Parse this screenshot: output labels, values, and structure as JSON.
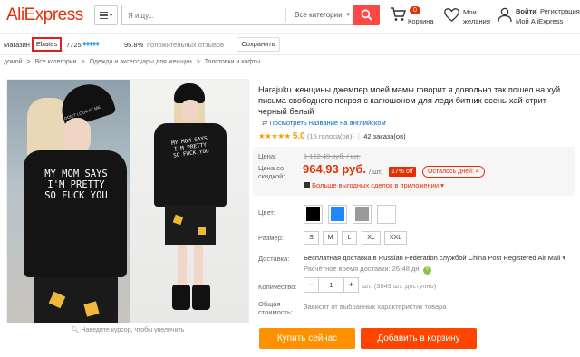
{
  "header": {
    "logo": "AliExpress",
    "search_placeholder": "Я ищу...",
    "category_select": "Все категории",
    "cart_count": "0",
    "cart_label": "Корзина",
    "wishlist_label_1": "Мои",
    "wishlist_label_2": "желания",
    "login_label": "Войти",
    "register_label": "Регистрация",
    "my_aliexpress": "Мой AliExpress"
  },
  "store": {
    "shop_label": "Магазин",
    "shop_name": "Ebates",
    "score": "7725",
    "positive_pct": "95.8%",
    "positive_label": "положительных отзывов",
    "save_button": "Сохранить"
  },
  "breadcrumb": {
    "items": [
      "домой",
      "Все категории",
      "Одежда и аксессуары для женщин",
      "Толстовки и кофты"
    ],
    "sep": ">"
  },
  "gallery": {
    "zoom_hint": "Наведите курсор, чтобы увеличить",
    "shirt_text_main": [
      "MY MOM SAYS",
      "I'M PRETTY",
      "SO FUCK YOU"
    ],
    "beanie_text": "DON'T LOOK AT ME"
  },
  "product": {
    "title": "Harajuku женщины джемпер моей мамы говорит я довольно так пошел на хуй письма свободного покроя с капюшоном для леди битник осень-хай-стрит черный белый",
    "view_english": "Посмотреть название на английском",
    "rating_value": "5.0",
    "votes": "(15 голоса(ов))",
    "orders": "42 заказа(ов)",
    "price_label": "Цена:",
    "old_price": "1 162,40 руб. / шт.",
    "discount_label_1": "Цена со",
    "discount_label_2": "скидкой:",
    "price": "964,93 руб.",
    "price_unit": "/ шт.",
    "discount_badge": "17% off",
    "days_left": "Осталось дней: 4",
    "app_deals": "Больше выгодных сделок в приложении",
    "color_label": "Цвет:",
    "colors": [
      "#000000",
      "#1e88ff",
      "#9a9a9a",
      "#ffffff"
    ],
    "size_label": "Размер:",
    "sizes": [
      "S",
      "M",
      "L",
      "XL",
      "XXL"
    ],
    "delivery_label": "Доставка:",
    "delivery_text": "Бесплатная доставка в Russian Federation службой China Post Registered Air Mail",
    "delivery_time": "Расчётное время доставки: 26-48 дн.",
    "qty_label": "Количество:",
    "qty_value": "1",
    "qty_available": "шт. (3849 шт. доступно)",
    "total_label_1": "Общая",
    "total_label_2": "стоимость:",
    "total_text": "Зависит от выбранных характеристик товара",
    "buy_now": "Купить сейчас",
    "add_to_cart": "Добавить в корзину"
  }
}
